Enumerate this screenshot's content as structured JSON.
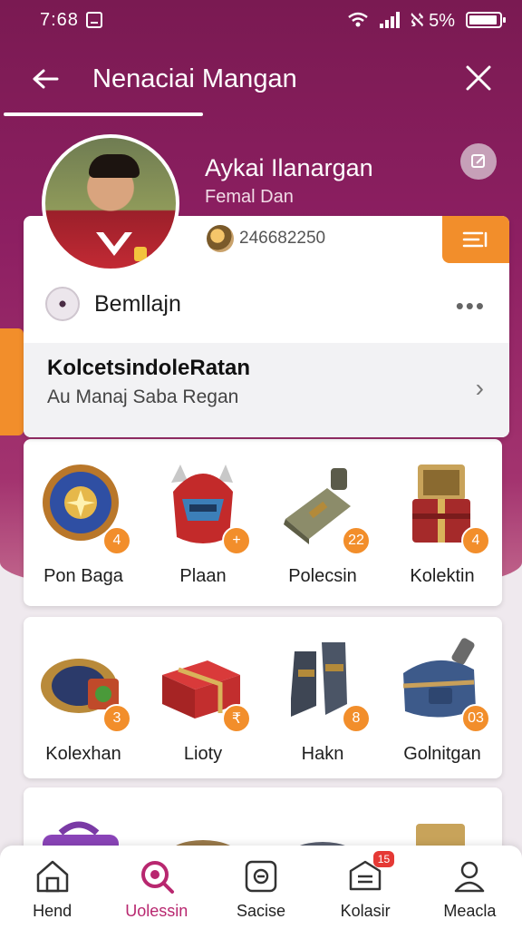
{
  "status_bar": {
    "time": "7:68",
    "battery_text": "ℵ 5%"
  },
  "header": {
    "title": "Nenaciai Mangan"
  },
  "profile": {
    "name": "Aykai Ilanargan",
    "subtitle": "Femal Dan",
    "coins": "246682250"
  },
  "section": {
    "title": "Bemllajn",
    "collection_title": "KolcetsindoleRatan",
    "collection_subtitle": "Au Manaj Saba Regan"
  },
  "grid_row1": [
    {
      "label": "Pon Baga",
      "badge": "4",
      "icon": "shield-icon"
    },
    {
      "label": "Plaan",
      "badge": "+",
      "icon": "helmet-icon"
    },
    {
      "label": "Polecsin",
      "badge": "22",
      "icon": "bottle-icon"
    },
    {
      "label": "Kolektin",
      "badge": "4",
      "icon": "chest-icon"
    }
  ],
  "grid_row2": [
    {
      "label": "Kolexhan",
      "badge": "3",
      "icon": "treasure-barrel-icon"
    },
    {
      "label": "Lioty",
      "badge": "₹",
      "icon": "red-chest-icon"
    },
    {
      "label": "Hakn",
      "badge": "8",
      "icon": "boots-icon"
    },
    {
      "label": "Golnitgan",
      "badge": "03",
      "icon": "backpack-icon"
    }
  ],
  "bottom_nav": [
    {
      "label": "Hend",
      "icon": "home-icon"
    },
    {
      "label": "Uolessin",
      "icon": "search-icon",
      "active": true
    },
    {
      "label": "Sacise",
      "icon": "camera-icon"
    },
    {
      "label": "Kolasir",
      "icon": "inbox-icon",
      "badge": "15"
    },
    {
      "label": "Meacla",
      "icon": "profile-icon"
    }
  ],
  "colors": {
    "primary": "#8d1f62",
    "accent": "#f28e2b",
    "active_nav": "#b8276f"
  }
}
